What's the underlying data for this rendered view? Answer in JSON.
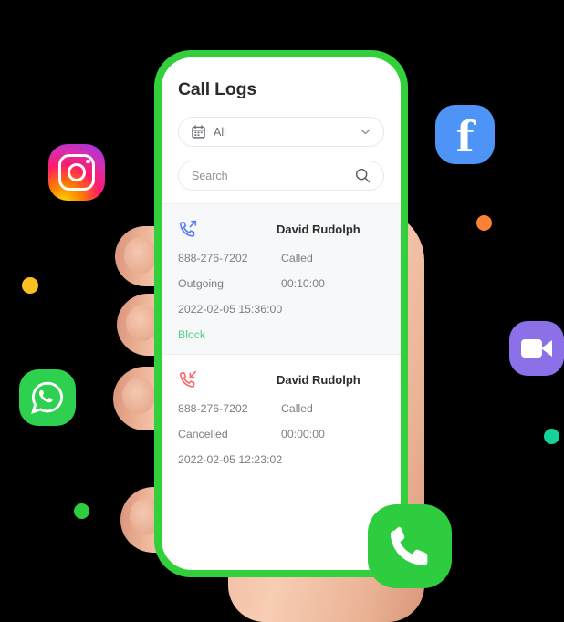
{
  "app": {
    "title": "Call Logs"
  },
  "filter": {
    "icon": "calendar-icon",
    "value": "All",
    "chevron": "chevron-down-icon"
  },
  "search": {
    "placeholder": "Search",
    "value": "",
    "icon": "search-icon"
  },
  "colors": {
    "phone_frame": "#32d03a",
    "outgoing_icon": "#5b7cf5",
    "missed_icon": "#fb6b6b",
    "block_link": "#4ecf85",
    "title_text": "#2c2c2c",
    "muted_text": "#7b7f85"
  },
  "call_logs": [
    {
      "direction_icon": "outgoing-call-icon",
      "name": "David Rudolph",
      "number": "888-276-7202",
      "status": "Called",
      "type": "Outgoing",
      "duration": "00:10:00",
      "timestamp": "2022-02-05 15:36:00",
      "action": "Block"
    },
    {
      "direction_icon": "missed-call-icon",
      "name": "David Rudolph",
      "number": "888-276-7202",
      "status": "Called",
      "type": "Cancelled",
      "duration": "00:00:00",
      "timestamp": "2022-02-05 12:23:02",
      "action": ""
    }
  ],
  "floating_icons": [
    {
      "name": "instagram-icon"
    },
    {
      "name": "facebook-icon"
    },
    {
      "name": "zoom-icon"
    },
    {
      "name": "whatsapp-icon"
    },
    {
      "name": "phone-call-icon"
    }
  ],
  "decorations": [
    {
      "name": "yellow-dot",
      "color": "#f9c022"
    },
    {
      "name": "orange-dot",
      "color": "#fb8137"
    },
    {
      "name": "teal-dot",
      "color": "#14d39a"
    },
    {
      "name": "green-dot",
      "color": "#2ecc3f"
    }
  ]
}
